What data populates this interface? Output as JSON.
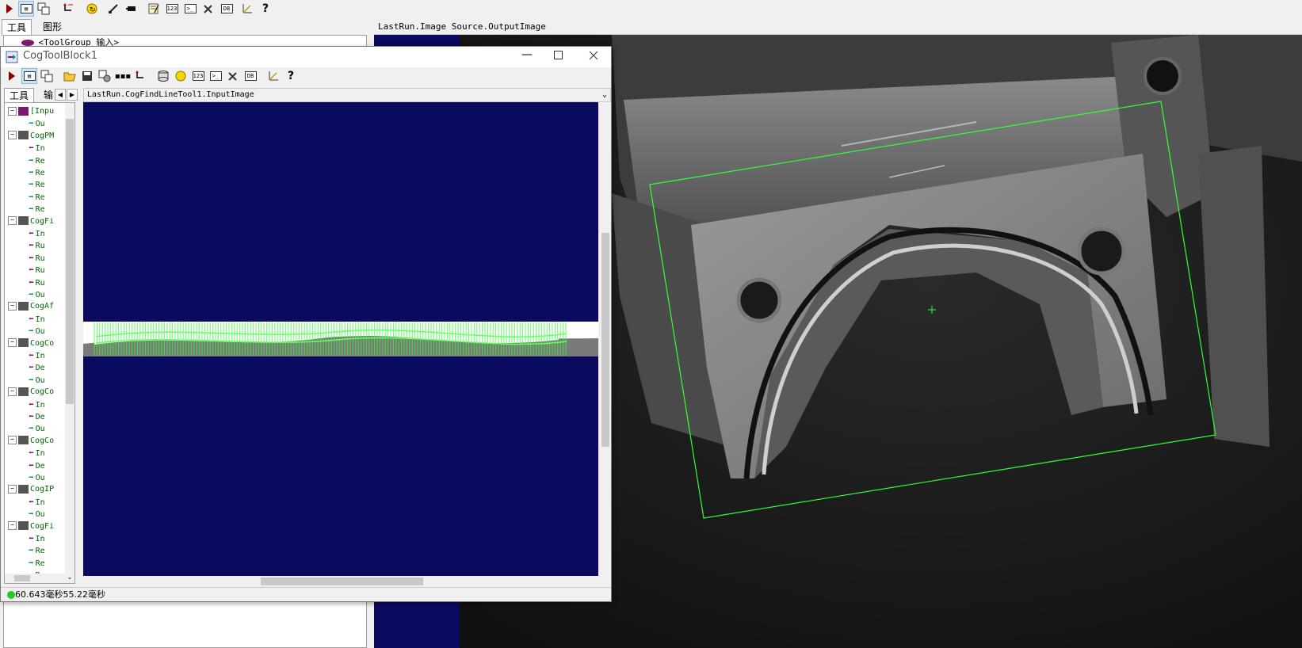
{
  "main_toolbar": {
    "icons": [
      "run-icon",
      "display-icon",
      "image-source-icon",
      "reset-icon",
      "loop-run-icon",
      "edit-icon",
      "record-icon",
      "notes-icon",
      "number-icon",
      "terminal-icon",
      "tools-icon",
      "db-icon",
      "ruler-icon",
      "help-icon"
    ]
  },
  "outer_panel": {
    "tabs": [
      "工具",
      "图形"
    ],
    "tree_first_item": "<ToolGroup 输入>"
  },
  "right_view": {
    "header": "LastRun.Image Source.OutputImage"
  },
  "window": {
    "title": "CogToolBlock1",
    "tabs": [
      "工具",
      "输"
    ],
    "view_header": "LastRun.CogFindLineTool1.InputImage",
    "status": "60.643毫秒55.22毫秒",
    "tree": [
      {
        "label": "[Inpu",
        "level": 0,
        "kind": "input"
      },
      {
        "label": "Ou",
        "level": 1,
        "kind": "out"
      },
      {
        "label": "CogPM",
        "level": 0,
        "kind": "tool"
      },
      {
        "label": "In",
        "level": 1,
        "kind": "in"
      },
      {
        "label": "Re",
        "level": 1,
        "kind": "out"
      },
      {
        "label": "Re",
        "level": 1,
        "kind": "out"
      },
      {
        "label": "Re",
        "level": 1,
        "kind": "out"
      },
      {
        "label": "Re",
        "level": 1,
        "kind": "out"
      },
      {
        "label": "Re",
        "level": 1,
        "kind": "out"
      },
      {
        "label": "CogFi",
        "level": 0,
        "kind": "tool"
      },
      {
        "label": "In",
        "level": 1,
        "kind": "in"
      },
      {
        "label": "Ru",
        "level": 1,
        "kind": "in"
      },
      {
        "label": "Ru",
        "level": 1,
        "kind": "in"
      },
      {
        "label": "Ru",
        "level": 1,
        "kind": "in"
      },
      {
        "label": "Ru",
        "level": 1,
        "kind": "in"
      },
      {
        "label": "Ou",
        "level": 1,
        "kind": "out"
      },
      {
        "label": "CogAf",
        "level": 0,
        "kind": "tool"
      },
      {
        "label": "In",
        "level": 1,
        "kind": "in"
      },
      {
        "label": "Ou",
        "level": 1,
        "kind": "out"
      },
      {
        "label": "CogCo",
        "level": 0,
        "kind": "tool"
      },
      {
        "label": "In",
        "level": 1,
        "kind": "in"
      },
      {
        "label": "De",
        "level": 1,
        "kind": "in"
      },
      {
        "label": "Ou",
        "level": 1,
        "kind": "out"
      },
      {
        "label": "CogCo",
        "level": 0,
        "kind": "tool"
      },
      {
        "label": "In",
        "level": 1,
        "kind": "in"
      },
      {
        "label": "De",
        "level": 1,
        "kind": "in"
      },
      {
        "label": "Ou",
        "level": 1,
        "kind": "out"
      },
      {
        "label": "CogCo",
        "level": 0,
        "kind": "tool"
      },
      {
        "label": "In",
        "level": 1,
        "kind": "in"
      },
      {
        "label": "De",
        "level": 1,
        "kind": "in"
      },
      {
        "label": "Ou",
        "level": 1,
        "kind": "out"
      },
      {
        "label": "CogIP",
        "level": 0,
        "kind": "tool"
      },
      {
        "label": "In",
        "level": 1,
        "kind": "in"
      },
      {
        "label": "Ou",
        "level": 1,
        "kind": "out"
      },
      {
        "label": "CogFi",
        "level": 0,
        "kind": "tool"
      },
      {
        "label": "In",
        "level": 1,
        "kind": "in"
      },
      {
        "label": "Re",
        "level": 1,
        "kind": "out"
      },
      {
        "label": "Re",
        "level": 1,
        "kind": "out"
      },
      {
        "label": "R",
        "level": 1,
        "kind": "out"
      }
    ]
  },
  "colors": {
    "in_arrow": "#7a1a6e",
    "out_arrow": "#1a8a8a",
    "tool_label": "#006400",
    "view_bg": "#0a0a5e",
    "graphic_green": "#33ff33",
    "status_led": "#22cc22"
  }
}
